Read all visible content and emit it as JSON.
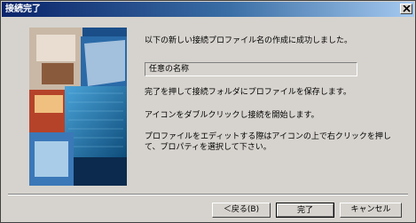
{
  "window": {
    "title": "接続完了",
    "close_glyph": "×"
  },
  "content": {
    "message_success": "以下の新しい接続プロファイル名の作成に成功しました。",
    "profile_name": "任意の名称",
    "message_save": "完了を押して接続フォルダにプロファイルを保存します。",
    "message_connect": "アイコンをダブルクリックし接続を開始します。",
    "message_edit": "プロファイルをエディットする際はアイコンの上で右クリックを押して、プロパティを選択して下さい。"
  },
  "buttons": {
    "back": "＜戻る(B)",
    "finish": "完了",
    "cancel": "キャンセル"
  },
  "colors": {
    "titlebar_start": "#0a246a",
    "titlebar_end": "#a6caf0",
    "face": "#d6d3ce"
  },
  "icons": {
    "close": "close-icon",
    "art": "wizard-banner-image"
  }
}
